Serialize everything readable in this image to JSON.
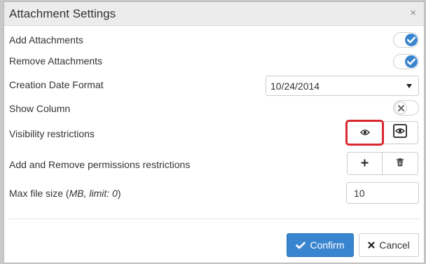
{
  "dialog": {
    "title": "Attachment Settings",
    "close_glyph": "×"
  },
  "settings": {
    "add_attachments": {
      "label": "Add Attachments",
      "enabled": true
    },
    "remove_attachments": {
      "label": "Remove Attachments",
      "enabled": true
    },
    "creation_date_format": {
      "label": "Creation Date Format",
      "value": "10/24/2014"
    },
    "show_column": {
      "label": "Show Column",
      "enabled": false
    },
    "visibility_restrictions": {
      "label": "Visibility restrictions",
      "icons": [
        "eye-icon",
        "eye-box-icon"
      ]
    },
    "add_remove_permissions": {
      "label": "Add and Remove permissions restrictions",
      "icons": [
        "plus-icon",
        "trash-icon"
      ]
    },
    "max_file_size": {
      "label_prefix": "Max file size (",
      "label_em": "MB, limit: 0",
      "label_suffix": ")",
      "value": "10"
    }
  },
  "footer": {
    "confirm_label": "Confirm",
    "cancel_label": "Cancel"
  },
  "colors": {
    "accent": "#3a85cf",
    "highlight": "#d9282f",
    "header_bg": "#ececec"
  }
}
